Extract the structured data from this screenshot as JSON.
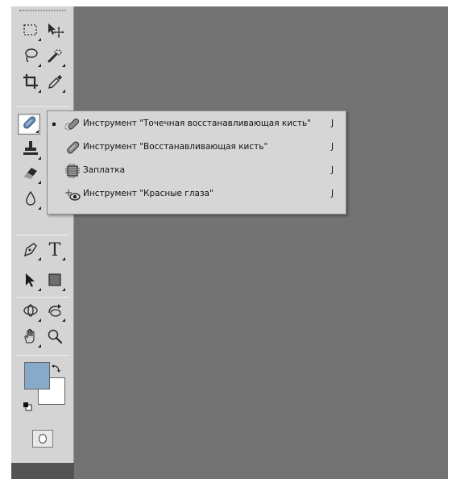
{
  "toolbar": {
    "tools": [
      {
        "name": "rectangular-marquee",
        "icon": "marquee-icon"
      },
      {
        "name": "move",
        "icon": "move-icon"
      },
      {
        "name": "lasso",
        "icon": "lasso-icon"
      },
      {
        "name": "quick-selection",
        "icon": "quick-selection-icon"
      },
      {
        "name": "crop",
        "icon": "crop-icon"
      },
      {
        "name": "eyedropper",
        "icon": "eyedropper-icon"
      },
      {
        "name": "spot-healing-brush",
        "icon": "spot-healing-brush-icon",
        "active": true
      },
      {
        "name": "clone-stamp",
        "icon": "clone-stamp-icon"
      },
      {
        "name": "eraser",
        "icon": "eraser-icon"
      },
      {
        "name": "blur",
        "icon": "blur-drop-icon"
      },
      {
        "name": "pen",
        "icon": "pen-icon"
      },
      {
        "name": "type",
        "icon": "type-icon",
        "glyph": "T"
      },
      {
        "name": "path-selection",
        "icon": "path-selection-arrow-icon"
      },
      {
        "name": "rectangle-shape",
        "icon": "rectangle-shape-icon"
      },
      {
        "name": "3d-rotate",
        "icon": "3d-rotate-icon"
      },
      {
        "name": "3d-orbit",
        "icon": "3d-orbit-icon"
      },
      {
        "name": "hand",
        "icon": "hand-icon"
      },
      {
        "name": "zoom",
        "icon": "zoom-icon"
      }
    ],
    "colors": {
      "foreground": "#87aac9",
      "background": "#ffffff",
      "toolbar_bg": "#d4d4d4",
      "canvas_bg": "#737373"
    }
  },
  "flyout": {
    "items": [
      {
        "label": "Инструмент \"Точечная восстанавливающая кисть\"",
        "shortcut": "J",
        "selected": true,
        "icon": "spot-healing-brush-icon"
      },
      {
        "label": "Инструмент \"Восстанавливающая кисть\"",
        "shortcut": "J",
        "selected": false,
        "icon": "healing-brush-icon"
      },
      {
        "label": "Заплатка",
        "shortcut": "J",
        "selected": false,
        "icon": "patch-icon"
      },
      {
        "label": "Инструмент \"Красные глаза\"",
        "shortcut": "J",
        "selected": false,
        "icon": "red-eye-icon"
      }
    ]
  }
}
